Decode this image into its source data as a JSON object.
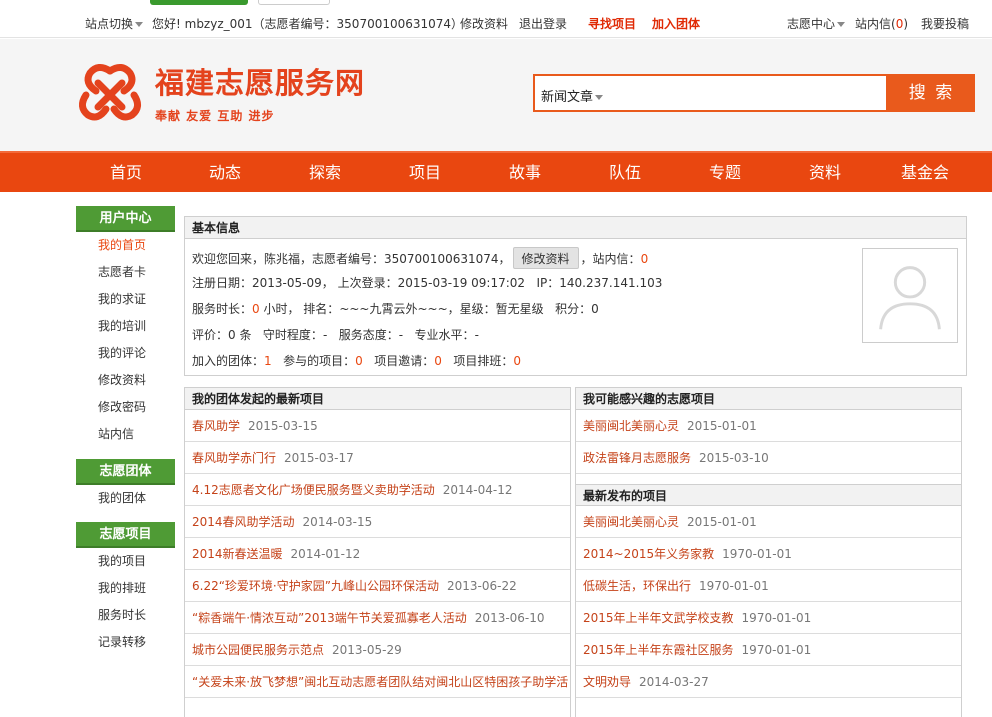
{
  "topbar": {
    "site_switch": "站点切换",
    "greeting": "您好! mbzyz_001（志愿者编号：350700100631074）",
    "edit_profile": "修改资料",
    "logout": "退出登录",
    "find_project": "寻找项目",
    "join_group": "加入团体",
    "volunteer_center": "志愿中心",
    "messages": "站内信",
    "message_count": "0",
    "submit": "我要投稿"
  },
  "header": {
    "site_name": "福建志愿服务网",
    "slogan": "奉献 友爱 互助 进步",
    "search_category": "新闻文章",
    "search_button": "搜 索"
  },
  "nav": [
    "首页",
    "动态",
    "探索",
    "项目",
    "故事",
    "队伍",
    "专题",
    "资料",
    "基金会"
  ],
  "sidebar": {
    "sections": [
      {
        "title": "用户中心",
        "items": [
          "我的首页",
          "志愿者卡",
          "我的求证",
          "我的培训",
          "我的评论",
          "修改资料",
          "修改密码",
          "站内信"
        ]
      },
      {
        "title": "志愿团体",
        "items": [
          "我的团体"
        ]
      },
      {
        "title": "志愿项目",
        "items": [
          "我的项目",
          "我的排班",
          "服务时长",
          "记录转移"
        ]
      }
    ],
    "active_item": "我的首页"
  },
  "basic": {
    "title": "基本信息",
    "welcome": "欢迎您回来，陈兆福，志愿者编号：350700100631074，",
    "edit_btn": "修改资料",
    "msg_label": "，站内信：",
    "msg_count": "0",
    "reg_label": "注册日期：",
    "reg_date": "2013-05-09",
    "last_login_label": "，  上次登录：",
    "last_login": "2015-03-19 09:17:02",
    "ip_label": "IP：",
    "ip": "140.237.141.103",
    "hours_label": "服务时长：",
    "hours": "0",
    "hours_unit": "小时，  排名：",
    "rank": "~~~九霄云外~~~",
    "star_label": "，星级：",
    "star": "暂无星级",
    "points_label": "积分：",
    "points": "0",
    "rating_label": "评价：",
    "rating_count": "0 条",
    "punctual_label": "守时程度：",
    "punctual": "-",
    "attitude_label": "服务态度：",
    "attitude": "-",
    "skill_label": "专业水平：",
    "skill": "-",
    "groups_label": "加入的团体：",
    "groups": "1",
    "projects_label": "参与的项目：",
    "projects": "0",
    "invites_label": "项目邀请：",
    "invites": "0",
    "shifts_label": "项目排班：",
    "shifts": "0"
  },
  "group_projects": {
    "title": "我的团体发起的最新项目",
    "items": [
      {
        "title": "春风助学",
        "date": "2015-03-15"
      },
      {
        "title": "春风助学赤门行",
        "date": "2015-03-17"
      },
      {
        "title": "4.12志愿者文化广场便民服务暨义卖助学活动",
        "date": "2014-04-12"
      },
      {
        "title": "2014春风助学活动",
        "date": "2014-03-15"
      },
      {
        "title": "2014新春送温暖",
        "date": "2014-01-12"
      },
      {
        "title": "6.22“珍爱环境·守护家园”九峰山公园环保活动",
        "date": "2013-06-22"
      },
      {
        "title": "“粽香端午·情浓互动”2013端午节关爱孤寡老人活动",
        "date": "2013-06-10"
      },
      {
        "title": "城市公园便民服务示范点",
        "date": "2013-05-29"
      },
      {
        "title": "“关爱未来·放飞梦想”闽北互动志愿者团队结对闽北山区特困孩子助学活",
        "date": ""
      }
    ]
  },
  "interest_projects": {
    "title": "我可能感兴趣的志愿项目",
    "items": [
      {
        "title": "美丽闽北美丽心灵",
        "date": "2015-01-01"
      },
      {
        "title": "政法雷锋月志愿服务",
        "date": "2015-03-10"
      }
    ]
  },
  "latest_projects": {
    "title": "最新发布的项目",
    "items": [
      {
        "title": "美丽闽北美丽心灵",
        "date": "2015-01-01"
      },
      {
        "title": "2014~2015年义务家教",
        "date": "1970-01-01"
      },
      {
        "title": "低碳生活，环保出行",
        "date": "1970-01-01"
      },
      {
        "title": "2015年上半年文武学校支教",
        "date": "1970-01-01"
      },
      {
        "title": "2015年上半年东霞社区服务",
        "date": "1970-01-01"
      },
      {
        "title": "文明劝导",
        "date": "2014-03-27"
      }
    ]
  }
}
